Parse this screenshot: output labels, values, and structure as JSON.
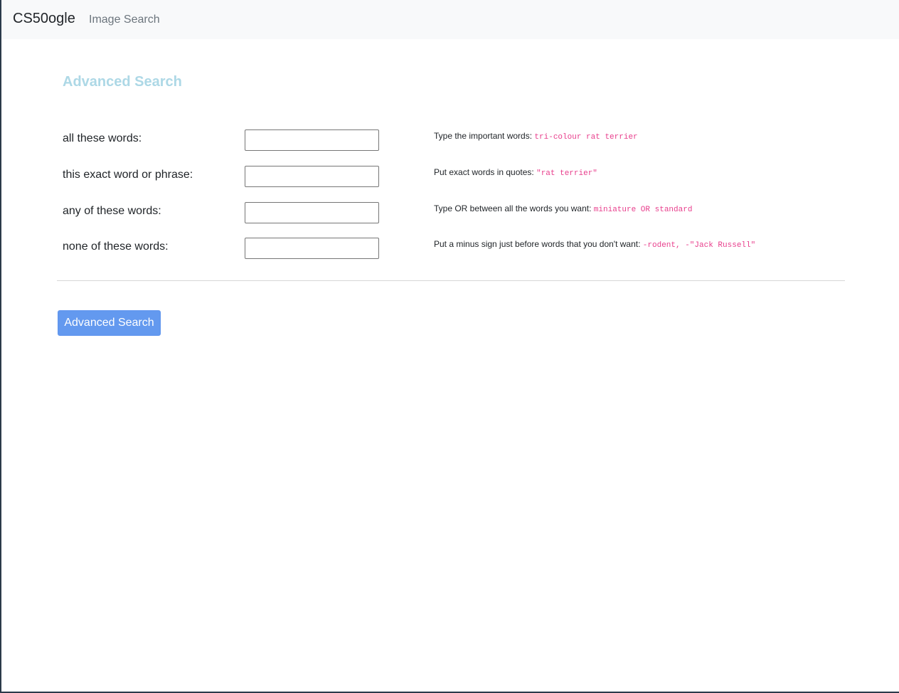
{
  "nav": {
    "brand": "CS50ogle",
    "links": [
      {
        "label": "Image Search"
      }
    ]
  },
  "page": {
    "heading": "Advanced Search"
  },
  "form": {
    "rows": [
      {
        "label": "all these words:",
        "value": "",
        "hint_text": "Type the important words:",
        "hint_code": "tri-colour rat terrier"
      },
      {
        "label": "this exact word or phrase:",
        "value": "",
        "hint_text": "Put exact words in quotes:",
        "hint_code": "\"rat terrier\""
      },
      {
        "label": "any of these words:",
        "value": "",
        "hint_text": "Type OR between all the words you want:",
        "hint_code": "miniature OR standard"
      },
      {
        "label": "none of these words:",
        "value": "",
        "hint_text": "Put a minus sign just before words that you don't want:",
        "hint_code": "-rodent, -\"Jack Russell\""
      }
    ],
    "submit_label": "Advanced Search"
  },
  "colors": {
    "heading": "#add8e6",
    "button": "#6399ef",
    "code": "#e83e8c",
    "navbar_bg": "#f8f9fa"
  }
}
